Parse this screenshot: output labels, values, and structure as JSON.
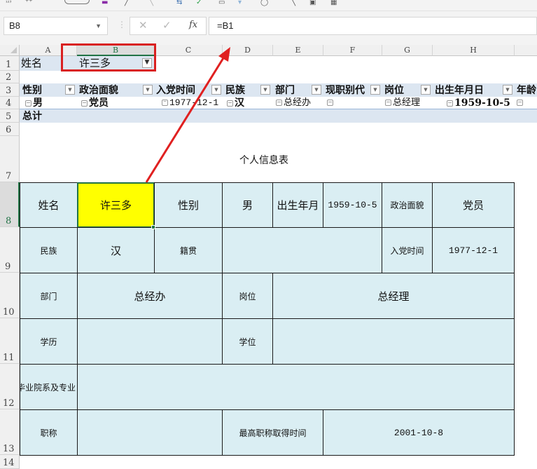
{
  "toolbar": {
    "icons": [
      "number-format-icon",
      "save-icon",
      "undo-icon",
      "redo-icon",
      "track-changes-icon",
      "accept-icon",
      "sheet-icon",
      "sort-icon",
      "filter-icon",
      "zoom-icon",
      "camera-icon",
      "calculator-icon"
    ]
  },
  "formula_bar": {
    "name_box": "B8",
    "cancel_symbol": "✕",
    "enter_symbol": "✓",
    "fx_label": "fx",
    "formula": "=B1"
  },
  "columns": [
    "A",
    "B",
    "C",
    "D",
    "E",
    "F",
    "G",
    "H"
  ],
  "rows": [
    "1",
    "2",
    "3",
    "4",
    "5",
    "6",
    "7",
    "8",
    "9",
    "10",
    "11",
    "12",
    "13",
    "14"
  ],
  "pivot": {
    "filter_label": "姓名",
    "filter_value": "许三多",
    "headers": [
      "性别",
      "政治面貌",
      "入党时间",
      "民族",
      "部门",
      "现职别代",
      "岗位",
      "出生年月日",
      "年龄"
    ],
    "values": [
      "男",
      "党员",
      "1977-12-1",
      "汉",
      "总经办",
      "",
      "总经理",
      "1959-10-5",
      ""
    ],
    "total_label": "总计"
  },
  "form": {
    "title": "个人信息表",
    "name_label": "姓名",
    "name_value": "许三多",
    "gender_label": "性别",
    "gender_value": "男",
    "birth_label": "出生年月",
    "birth_value": "1959-10-5",
    "political_label": "政治面貌",
    "political_value": "党员",
    "ethnicity_label": "民族",
    "ethnicity_value": "汉",
    "native_label": "籍贯",
    "native_value": "",
    "party_date_label": "入党时间",
    "party_date_value": "1977-12-1",
    "dept_label": "部门",
    "dept_value": "总经办",
    "post_label": "岗位",
    "post_value": "总经理",
    "education_label": "学历",
    "education_value": "",
    "degree_label": "学位",
    "degree_value": "",
    "school_label": "毕业院系及专业",
    "school_value": "",
    "title_label": "职称",
    "title_value": "",
    "title_date_label": "最高职称取得时间",
    "title_date_value": "2001-10-8"
  },
  "annotations": {
    "highlight_color": "#d92020",
    "arrow_color": "#e02020"
  }
}
